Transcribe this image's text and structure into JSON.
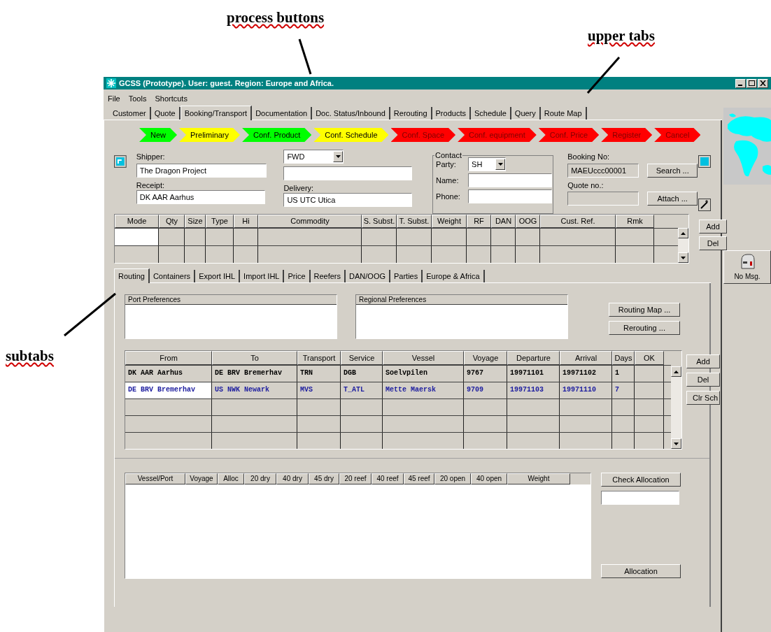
{
  "annotations": [
    {
      "text": "process buttons"
    },
    {
      "text": "upper tabs"
    },
    {
      "text": "subtabs"
    }
  ],
  "window": {
    "title": "GCSS (Prototype).  User: guest.  Region: Europe and Africa."
  },
  "menu": [
    "File",
    "Tools",
    "Shortcuts"
  ],
  "tabs": [
    {
      "label": "Customer",
      "selected": false
    },
    {
      "label": "Quote",
      "selected": false
    },
    {
      "label": "Booking/Transport",
      "selected": true
    },
    {
      "label": "Documentation",
      "selected": false
    },
    {
      "label": "Doc. Status/Inbound",
      "selected": false
    },
    {
      "label": "Rerouting",
      "selected": false
    },
    {
      "label": "Products",
      "selected": false
    },
    {
      "label": "Schedule",
      "selected": false
    },
    {
      "label": "Query",
      "selected": false
    },
    {
      "label": "Route Map",
      "selected": false
    }
  ],
  "process_buttons": [
    {
      "label": "New",
      "color": "#00ff00"
    },
    {
      "label": "Preliminary",
      "color": "#ffff00"
    },
    {
      "label": "Conf. Product",
      "color": "#00ff00"
    },
    {
      "label": "Conf. Schedule",
      "color": "#ffff00"
    },
    {
      "label": "Conf. Space",
      "color": "#ff0000"
    },
    {
      "label": "Conf. equipment",
      "color": "#ff0000"
    },
    {
      "label": "Conf. Price",
      "color": "#ff0000"
    },
    {
      "label": "Register",
      "color": "#ff0000"
    },
    {
      "label": "Cancel",
      "color": "#ff0000"
    }
  ],
  "form": {
    "shipper_label": "Shipper:",
    "shipper": "The Dragon Project",
    "shipper_code": "FWD",
    "receipt_label": "Receipt:",
    "receipt": "DK AAR Aarhus",
    "delivery_label": "Delivery:",
    "delivery": "US UTC Utica",
    "contact": {
      "title": "Contact",
      "party_label": "Party:",
      "party": "SH",
      "name_label": "Name:",
      "phone_label": "Phone:"
    },
    "booking_label": "Booking No:",
    "booking_no": "MAEUccc00001",
    "quote_label": "Quote no.:",
    "search_button": "Search ...",
    "attach_button": "Attach ..."
  },
  "cargo_table": {
    "columns": [
      "Mode",
      "Qty",
      "Size",
      "Type",
      "Hi",
      "Commodity",
      "S. Subst.",
      "T. Subst.",
      "Weight",
      "RF",
      "DAN",
      "OOG",
      "Cust. Ref.",
      "Rmk"
    ],
    "buttons": [
      "Add",
      "Del"
    ]
  },
  "subtabs": [
    {
      "label": "Routing",
      "selected": true
    },
    {
      "label": "Containers",
      "selected": false
    },
    {
      "label": "Export IHL",
      "selected": false
    },
    {
      "label": "Import IHL",
      "selected": false
    },
    {
      "label": "Price",
      "selected": false
    },
    {
      "label": "Reefers",
      "selected": false
    },
    {
      "label": "DAN/OOG",
      "selected": false
    },
    {
      "label": "Parties",
      "selected": false
    },
    {
      "label": "Europe & Africa",
      "selected": false
    }
  ],
  "preferences": [
    "Port Preferences",
    "Regional Preferences"
  ],
  "routing_buttons": [
    "Routing Map ...",
    "Rerouting ..."
  ],
  "routing_table": {
    "columns": [
      "From",
      "To",
      "Transport",
      "Service",
      "Vessel",
      "Voyage",
      "Departure",
      "Arrival",
      "Days",
      "OK"
    ],
    "rows": [
      {
        "selected": false,
        "cells": [
          "DK AAR Aarhus",
          "DE BRV Bremerhav",
          "TRN",
          "DGB",
          "Soelvpilen",
          "9767",
          "19971101",
          "19971102",
          "1"
        ]
      },
      {
        "selected": true,
        "cells": [
          "DE BRV Bremerhav",
          "US NWK Newark",
          "MVS",
          "T_ATL",
          "Mette Maersk",
          "9709",
          "19971103",
          "19971110",
          "7"
        ]
      }
    ],
    "buttons": [
      "Add",
      "Del",
      "Clr Sch"
    ]
  },
  "allocation_table": {
    "columns": [
      "Vessel/Port",
      "Voyage",
      "Alloc",
      "20 dry",
      "40 dry",
      "45 dry",
      "20 reef",
      "40 reef",
      "45 reef",
      "20 open",
      "40 open",
      "Weight"
    ]
  },
  "check_allocation_button": "Check Allocation",
  "allocation_button": "Allocation",
  "sidebar": {
    "message_button": "No Msg."
  }
}
